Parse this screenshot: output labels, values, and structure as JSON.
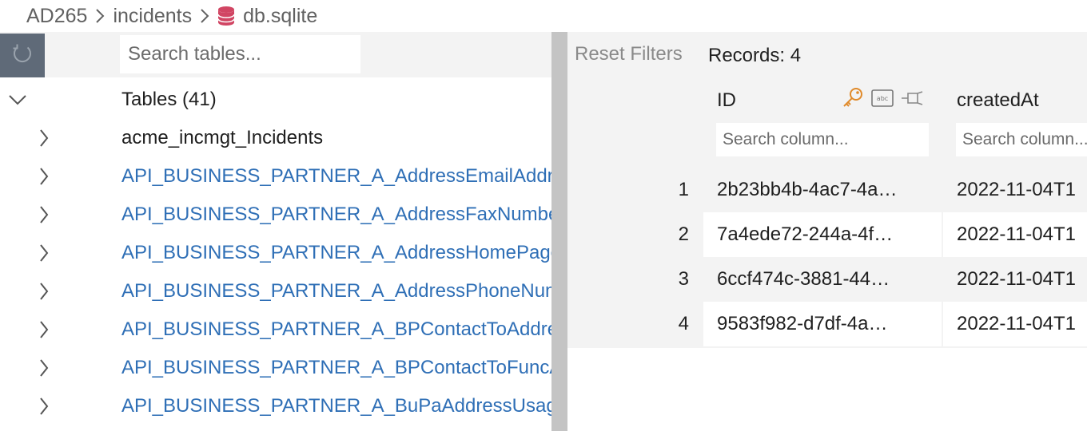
{
  "breadcrumb": {
    "items": [
      "AD265",
      "incidents",
      "db.sqlite"
    ]
  },
  "colors": {
    "db_icon": "#d14563",
    "link": "#2f6fb6",
    "key_icon": "#e08a2a"
  },
  "sidebar": {
    "search_placeholder": "Search tables...",
    "group_label": "Tables (41)",
    "tables": [
      "acme_incmgt_Incidents",
      "API_BUSINESS_PARTNER_A_AddressEmailAddress",
      "API_BUSINESS_PARTNER_A_AddressFaxNumber",
      "API_BUSINESS_PARTNER_A_AddressHomePageURL",
      "API_BUSINESS_PARTNER_A_AddressPhoneNumber",
      "API_BUSINESS_PARTNER_A_BPContactToAddress",
      "API_BUSINESS_PARTNER_A_BPContactToFuncAndDept",
      "API_BUSINESS_PARTNER_A_BuPaAddressUsage"
    ]
  },
  "grid": {
    "reset_filters_label": "Reset Filters",
    "records_label": "Records: 4",
    "columns": [
      {
        "name": "ID",
        "search_placeholder": "Search column..."
      },
      {
        "name": "createdAt",
        "search_placeholder": "Search column..."
      }
    ],
    "rows": [
      {
        "num": "1",
        "id": "2b23bb4b-4ac7-4a…",
        "createdAt": "2022-11-04T1"
      },
      {
        "num": "2",
        "id": "7a4ede72-244a-4f…",
        "createdAt": "2022-11-04T1"
      },
      {
        "num": "3",
        "id": "6ccf474c-3881-44…",
        "createdAt": "2022-11-04T1"
      },
      {
        "num": "4",
        "id": "9583f982-d7df-4a…",
        "createdAt": "2022-11-04T1"
      }
    ]
  }
}
